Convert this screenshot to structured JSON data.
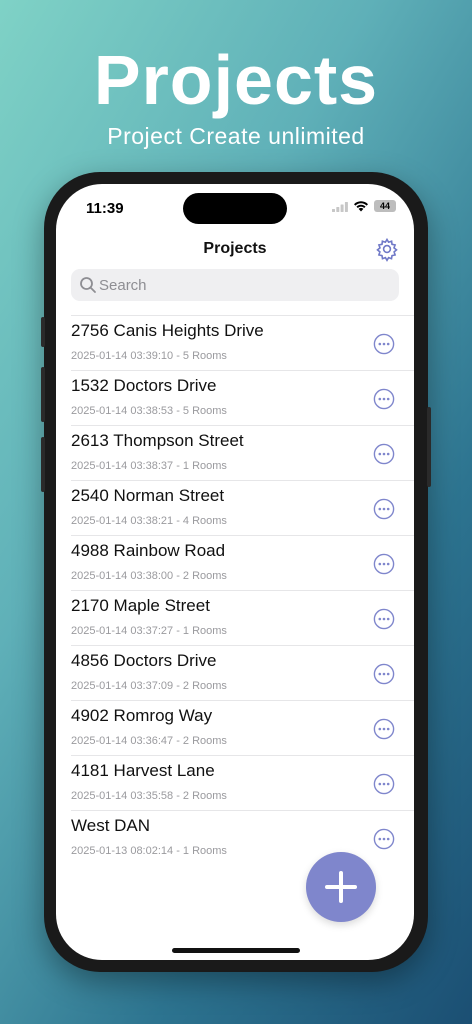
{
  "hero": {
    "title": "Projects",
    "subtitle": "Project Create unlimited"
  },
  "status_bar": {
    "time": "11:39",
    "battery": "44",
    "icons": [
      "signal-icon",
      "wifi-icon",
      "battery-icon"
    ]
  },
  "nav": {
    "title": "Projects",
    "settings_icon": "gear-icon"
  },
  "search": {
    "placeholder": "Search",
    "value": ""
  },
  "projects": [
    {
      "name": "2756 Canis Heights Drive",
      "meta": "2025-01-14 03:39:10 - 5 Rooms"
    },
    {
      "name": "1532 Doctors Drive",
      "meta": "2025-01-14 03:38:53 - 5 Rooms"
    },
    {
      "name": "2613 Thompson Street",
      "meta": "2025-01-14 03:38:37 - 1 Rooms"
    },
    {
      "name": "2540 Norman Street",
      "meta": "2025-01-14 03:38:21 - 4 Rooms"
    },
    {
      "name": "4988 Rainbow Road",
      "meta": "2025-01-14 03:38:00 - 2 Rooms"
    },
    {
      "name": "2170 Maple Street",
      "meta": "2025-01-14 03:37:27 - 1 Rooms"
    },
    {
      "name": "4856 Doctors Drive",
      "meta": "2025-01-14 03:37:09 - 2 Rooms"
    },
    {
      "name": "4902 Romrog Way",
      "meta": "2025-01-14 03:36:47 - 2 Rooms"
    },
    {
      "name": "4181 Harvest Lane",
      "meta": "2025-01-14 03:35:58 - 2 Rooms"
    },
    {
      "name": "West DAN",
      "meta": "2025-01-13 08:02:14 - 1 Rooms"
    }
  ],
  "colors": {
    "accent": "#7f86cc",
    "title_text": "#111111",
    "meta_text": "#9a9a9e",
    "background_start": "#7fd2c6",
    "background_end": "#1b4f73"
  },
  "fab": {
    "icon": "plus-icon"
  }
}
